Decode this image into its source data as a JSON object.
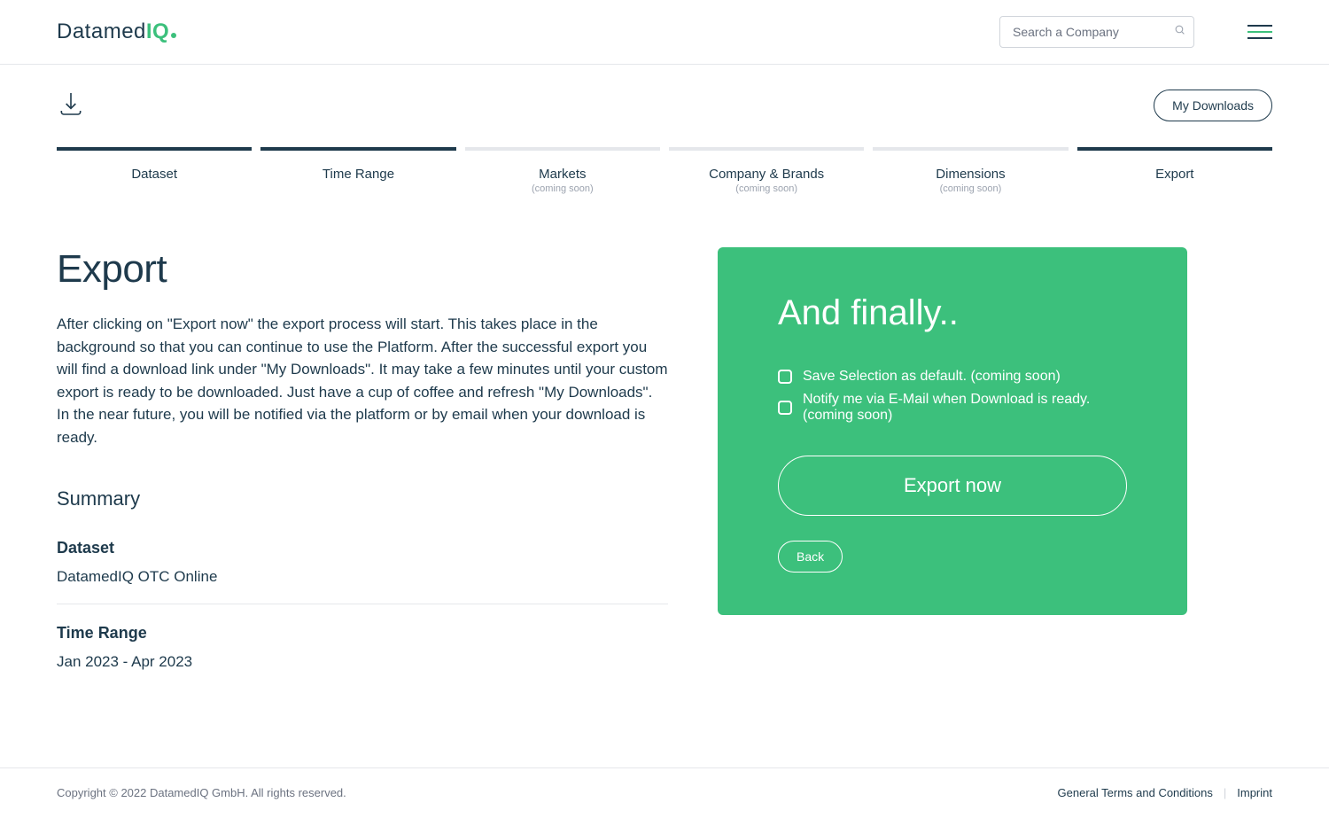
{
  "header": {
    "logo_prefix": "Datamed",
    "logo_suffix": "IQ",
    "search_placeholder": "Search a Company"
  },
  "top": {
    "my_downloads_label": "My Downloads"
  },
  "steps": [
    {
      "label": "Dataset",
      "active": true,
      "sub": ""
    },
    {
      "label": "Time Range",
      "active": true,
      "sub": ""
    },
    {
      "label": "Markets",
      "active": false,
      "sub": "(coming soon)"
    },
    {
      "label": "Company & Brands",
      "active": false,
      "sub": "(coming soon)"
    },
    {
      "label": "Dimensions",
      "active": false,
      "sub": "(coming soon)"
    },
    {
      "label": "Export",
      "active": true,
      "sub": ""
    }
  ],
  "page": {
    "title": "Export",
    "description": "After clicking on \"Export now\" the export process will start. This takes place in the background so that you can continue to use the Platform. After the successful export you will find a download link under \"My Downloads\". It may take a few minutes until your custom export is ready to be downloaded. Just have a cup of coffee and refresh \"My Downloads\". In the near future, you will be notified via the platform or by email when your download is ready.",
    "summary_title": "Summary",
    "summary": [
      {
        "label": "Dataset",
        "value": "DatamedIQ OTC Online"
      },
      {
        "label": "Time Range",
        "value": "Jan 2023 - Apr 2023"
      }
    ]
  },
  "panel": {
    "title": "And finally..",
    "checkbox1": "Save Selection as default. (coming soon)",
    "checkbox2": "Notify me via E-Mail when Download is ready. (coming soon)",
    "export_label": "Export now",
    "back_label": "Back"
  },
  "footer": {
    "copyright": "Copyright © 2022 DatamedIQ GmbH. All rights reserved.",
    "terms_label": "General Terms and Conditions",
    "imprint_label": "Imprint"
  }
}
